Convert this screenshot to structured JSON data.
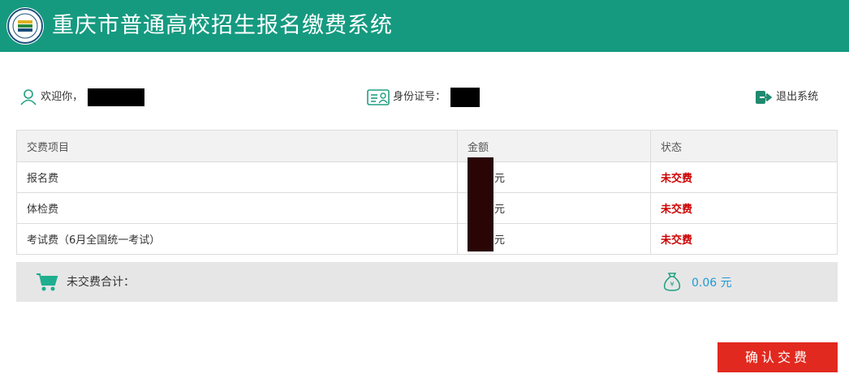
{
  "header": {
    "title": "重庆市普通高校招生报名缴费系统"
  },
  "user": {
    "welcome_label": "欢迎你，",
    "id_label": "身份证号：",
    "logout_label": "退出系统"
  },
  "table": {
    "headers": [
      "交费项目",
      "金额",
      "状态"
    ],
    "rows": [
      {
        "item": "报名费",
        "unit": "元",
        "status": "未交费"
      },
      {
        "item": "体检费",
        "unit": "元",
        "status": "未交费"
      },
      {
        "item": "考试费（6月全国统一考试）",
        "unit": "元",
        "status": "未交费"
      }
    ]
  },
  "summary": {
    "label": "未交费合计：",
    "total": "0.06 元"
  },
  "actions": {
    "confirm_label": "确认交费"
  },
  "colors": {
    "header": "#159a80",
    "status": "#cc0000",
    "total": "#1e9ad6",
    "button": "#e2291f"
  }
}
